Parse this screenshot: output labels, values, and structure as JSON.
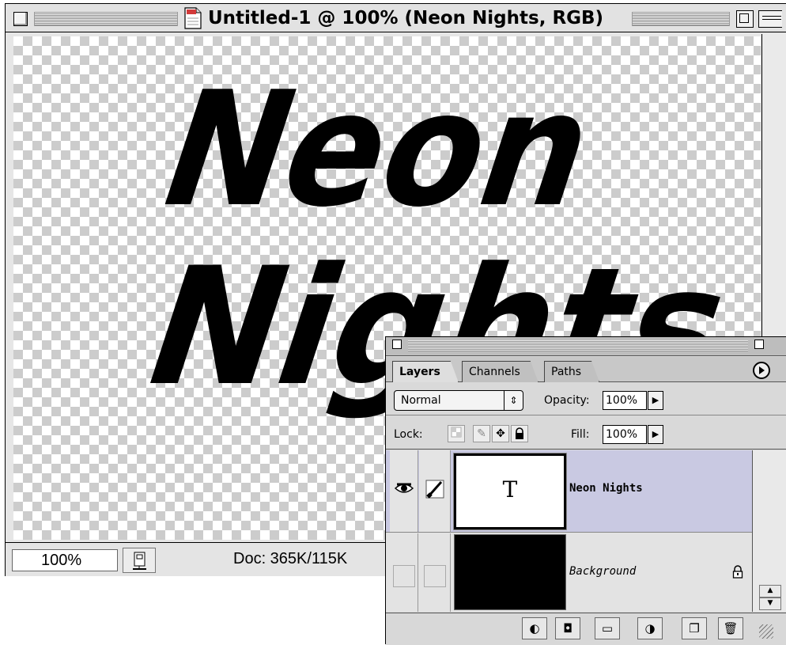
{
  "document": {
    "title": "Untitled-1 @ 100% (Neon Nights, RGB)",
    "canvas_text_line1": "Neon",
    "canvas_text_line2": "Nights"
  },
  "status": {
    "zoom": "100%",
    "doc_size": "Doc: 365K/115K"
  },
  "palette": {
    "tabs": [
      "Layers",
      "Channels",
      "Paths"
    ],
    "active_tab": "Layers",
    "blend_mode": "Normal",
    "opacity_label": "Opacity:",
    "opacity_value": "100%",
    "lock_label": "Lock:",
    "fill_label": "Fill:",
    "fill_value": "100%",
    "layers": [
      {
        "name": "Neon Nights",
        "thumbnail_glyph": "T",
        "visible": true,
        "selected": true
      },
      {
        "name": "Background",
        "locked": true,
        "visible": false
      }
    ]
  },
  "colors": {
    "selected_layer": "#c9c9e2",
    "chrome": "#e2e2e2",
    "checker": "#cccccc"
  },
  "icons": [
    "close-box-icon",
    "document-icon",
    "zoom-box-icon",
    "collapse-box-icon",
    "palette-menu-icon",
    "eye-icon",
    "brush-icon",
    "lock-icon",
    "lock-transparency-icon",
    "lock-paint-icon",
    "lock-move-icon",
    "lock-all-icon",
    "layer-style-icon",
    "mask-icon",
    "folder-icon",
    "adjustment-layer-icon",
    "new-layer-icon",
    "trash-icon"
  ]
}
